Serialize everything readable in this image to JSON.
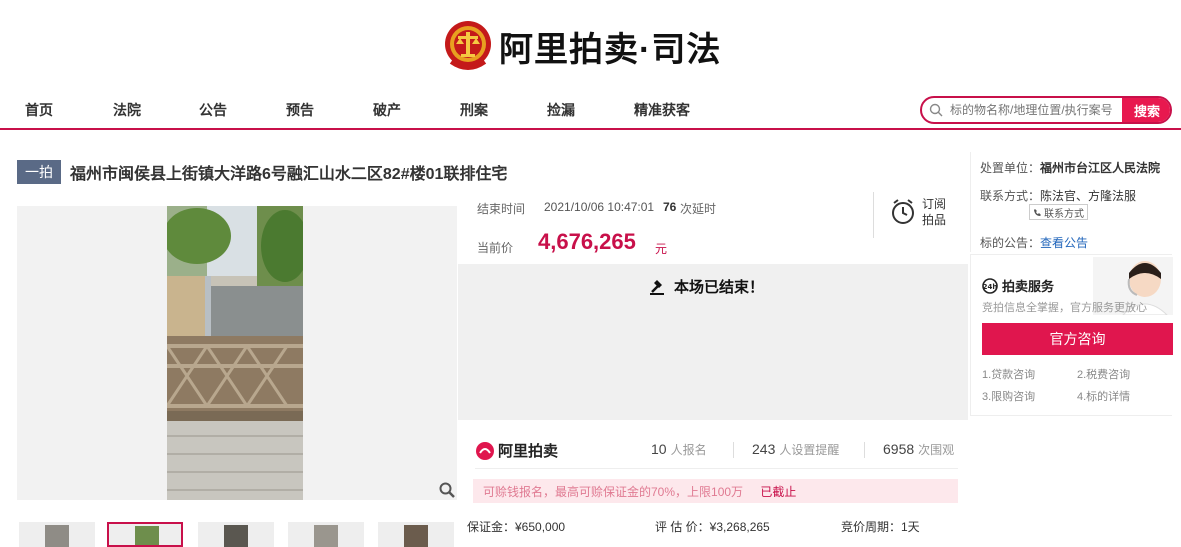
{
  "brand": {
    "name": "阿里拍卖·司法"
  },
  "nav": {
    "items": [
      "首页",
      "法院",
      "公告",
      "预告",
      "破产",
      "刑案",
      "捡漏",
      "精准获客"
    ],
    "search_placeholder": "标的物名称/地理位置/执行案号",
    "search_button": "搜索"
  },
  "item": {
    "badge": "一拍",
    "title": "福州市闽侯县上街镇大洋路6号融汇山水二区82#楼01联排住宅"
  },
  "auction": {
    "end_label": "结束时间",
    "end_time": "2021/10/06 10:47:01",
    "delay_count": "76",
    "delay_text": "次延时",
    "price_label": "当前价",
    "price": "4,676,265",
    "price_unit": "元",
    "subscribe_label": "订阅拍品",
    "ended_message": "本场已结束！"
  },
  "stats": {
    "logo_text": "阿里拍卖",
    "signups": "10",
    "signups_label": "人报名",
    "reminders": "243",
    "reminders_label": "人设置提醒",
    "views": "6958",
    "views_label": "次围观",
    "notice": "可赊钱报名，最高可赊保证金的70%，上限100万",
    "notice_link": "已截止",
    "deposit": "保证金：¥650,000",
    "assessment": "评 估 价：¥3,268,265",
    "period": "竞价周期：1天"
  },
  "sidebar": {
    "court_label": "处置单位：",
    "court": "福州市台江区人民法院",
    "contact_label": "联系方式：",
    "contact": "陈法官、方隆法服",
    "contact_tag": "联系方式",
    "notice_label": "标的公告：",
    "notice_link": "查看公告",
    "service_title": "拍卖服务",
    "service_sub": "竞拍信息全掌握，官方服务更放心",
    "consult_button": "官方咨询",
    "service_items": [
      "1.贷款咨询",
      "2.税费咨询",
      "3.限购咨询",
      "4.标的详情"
    ]
  },
  "colors": {
    "accent": "#c8104a",
    "button": "#e0164e",
    "badge": "#5a6a86"
  }
}
